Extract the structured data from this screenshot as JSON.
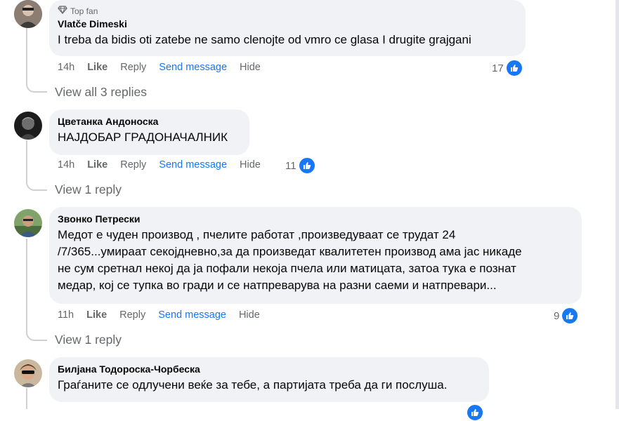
{
  "comments": [
    {
      "badge": "Top fan",
      "author": "Vlatče Dimeski",
      "text": [
        "I treba da bidis oti zatebe ne samo clenojte od vmro ce glasa I drugite grajgani"
      ],
      "time": "14h",
      "like": "Like",
      "reply": "Reply",
      "send": "Send message",
      "hide": "Hide",
      "reactions": "17",
      "view_replies": "View all 3 replies"
    },
    {
      "author": "Цветанка Андоноска",
      "text": [
        "НАЈДОБАР ГРАДОНАЧАЛНИК"
      ],
      "time": "14h",
      "like": "Like",
      "reply": "Reply",
      "send": "Send message",
      "hide": "Hide",
      "reactions": "11",
      "view_replies": "View 1 reply"
    },
    {
      "author": "Звонко Петрески",
      "text": [
        "Медот е чуден производ , пчелите работат ,произведуваат се трудат 24",
        "/7/365...умираат секојдневно,за да произведат квалитетен производ ама јас никаде",
        "не сум сретнал некој да ја пофали некоја пчела или матицата, затоа тука е познат",
        "медар, кој се тупка во гради и се натпреварува на разни саеми и натпревари..."
      ],
      "time": "11h",
      "like": "Like",
      "reply": "Reply",
      "send": "Send message",
      "hide": "Hide",
      "reactions": "9",
      "view_replies": "View 1 reply"
    },
    {
      "author": "Билјана Тодороска-Чорбеска",
      "text": [
        "Граѓаните се одлучени веќе за тебе, а партијата треба да ги послуша."
      ]
    }
  ],
  "icons": {
    "badge": "diamond-icon",
    "reaction": "thumbs-up-icon"
  },
  "colors": {
    "link_blue": "#1877f2",
    "bubble": "#f0f2f5",
    "muted": "#65676b"
  }
}
